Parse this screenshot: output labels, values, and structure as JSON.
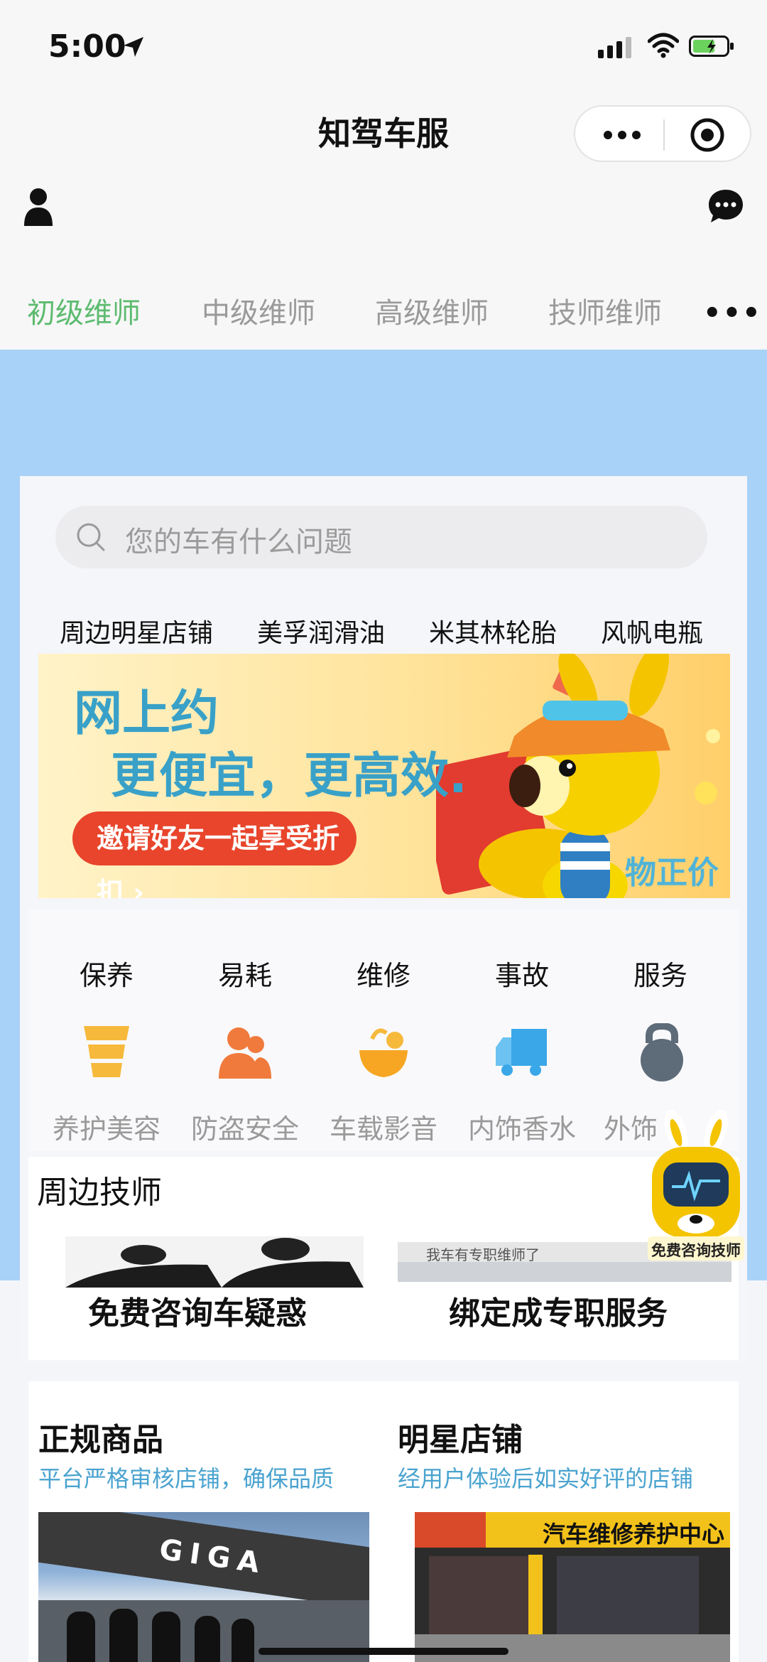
{
  "status_bar": {
    "time": "5:00"
  },
  "nav": {
    "title": "知驾车服"
  },
  "tabs": [
    {
      "label": "初级维师",
      "active": true
    },
    {
      "label": "中级维师",
      "active": false
    },
    {
      "label": "高级维师",
      "active": false
    },
    {
      "label": "技师维师",
      "active": false
    }
  ],
  "tabs_more": "•••",
  "search": {
    "placeholder": "您的车有什么问题"
  },
  "hot_links": [
    "周边明星店铺",
    "美孚润滑油",
    "米其林轮胎",
    "风帆电瓶"
  ],
  "banner": {
    "line1": "网上约",
    "line2": "更便宜，更高效.",
    "button": "邀请好友一起享受折扣 ›",
    "corner": "物正价廉"
  },
  "categories": [
    "保养",
    "易耗",
    "维修",
    "事故",
    "服务"
  ],
  "sub_categories": [
    {
      "label": "养护美容",
      "icon": "stack-icon"
    },
    {
      "label": "防盗安全",
      "icon": "people-icon"
    },
    {
      "label": "车载影音",
      "icon": "bowl-icon"
    },
    {
      "label": "内饰香水",
      "icon": "truck-icon"
    },
    {
      "label": "外饰",
      "icon": "kettlebell-icon"
    }
  ],
  "robot_label": "免费咨询技师",
  "techs": {
    "title": "周边技师",
    "cards": [
      {
        "caption": "免费咨询车疑惑"
      },
      {
        "caption": "绑定成专职服务",
        "image_text": "我车有专职维师了"
      }
    ]
  },
  "goods": [
    {
      "title": "正规商品",
      "subtitle": "平台严格审核店铺，确保品质",
      "photo_text": "GIGA"
    },
    {
      "title": "明星店铺",
      "subtitle": "经用户体验后如实好评的店铺",
      "photo_text": "汽车维修养护中心"
    }
  ],
  "colors": {
    "accent_green": "#5dbb6f",
    "sky_blue": "#a9d2f8",
    "link_blue": "#4aa3cf"
  }
}
